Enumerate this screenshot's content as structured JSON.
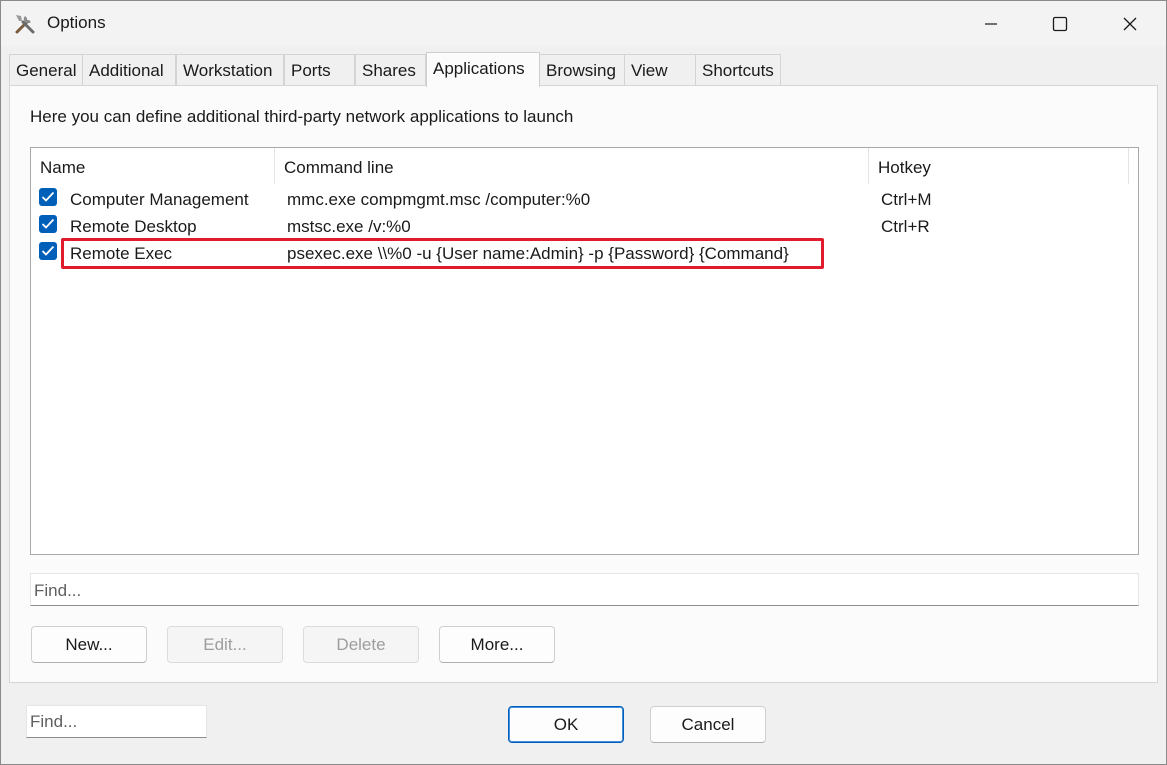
{
  "window": {
    "title": "Options",
    "icon": "tools-icon"
  },
  "tabs": [
    {
      "label": "General"
    },
    {
      "label": "Additional"
    },
    {
      "label": "Workstation"
    },
    {
      "label": "Ports"
    },
    {
      "label": "Shares"
    },
    {
      "label": "Applications",
      "active": true
    },
    {
      "label": "Browsing"
    },
    {
      "label": "View"
    },
    {
      "label": "Shortcuts"
    }
  ],
  "panel": {
    "intro": "Here you can define additional third-party network applications to launch",
    "columns": [
      "Name",
      "Command line",
      "Hotkey"
    ],
    "rows": [
      {
        "checked": true,
        "name": "Computer Management",
        "command": "mmc.exe compmgmt.msc /computer:%0",
        "hotkey": "Ctrl+M"
      },
      {
        "checked": true,
        "name": "Remote Desktop",
        "command": "mstsc.exe /v:%0",
        "hotkey": "Ctrl+R"
      },
      {
        "checked": true,
        "name": "Remote Exec",
        "command": "psexec.exe \\\\%0 -u {User name:Admin} -p {Password} {Command}",
        "hotkey": ""
      }
    ],
    "find_placeholder": "Find...",
    "buttons": {
      "new": "New...",
      "edit": "Edit...",
      "delete": "Delete",
      "more": "More..."
    }
  },
  "footer": {
    "find_placeholder": "Find...",
    "ok": "OK",
    "cancel": "Cancel"
  },
  "colors": {
    "accent": "#005fb8",
    "highlight": "#e01b2b"
  }
}
